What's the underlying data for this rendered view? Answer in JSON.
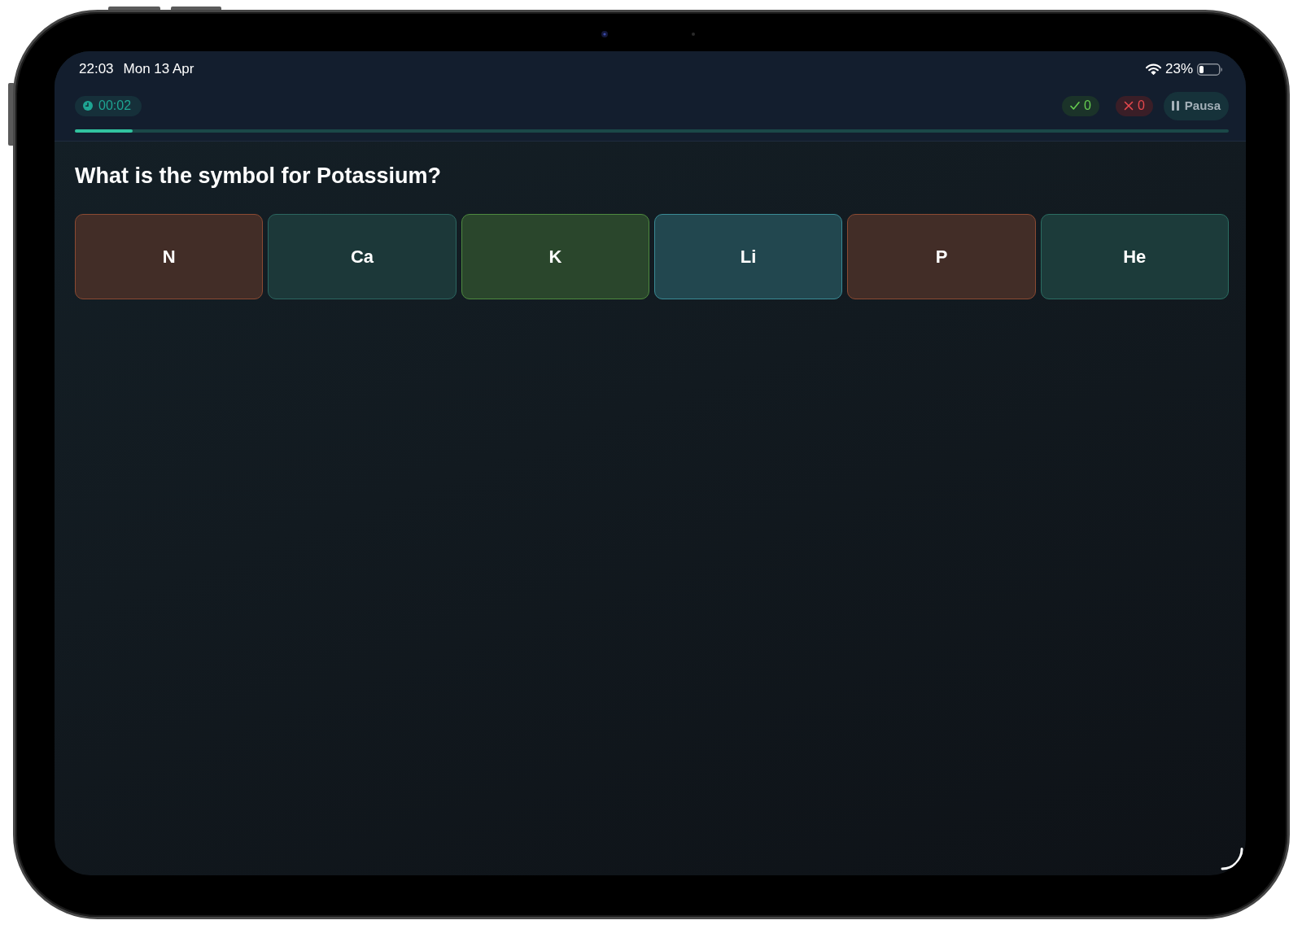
{
  "status_bar": {
    "time": "22:03",
    "date": "Mon 13 Apr",
    "battery": "23%"
  },
  "quiz_bar": {
    "timer": "00:02",
    "correct": "0",
    "wrong": "0",
    "pause_button": "Pausa",
    "progress": {
      "level": 0.05
    }
  },
  "question": "What is the symbol for Potassium?",
  "options": [
    {
      "label": "N",
      "color": "#8b4a32"
    },
    {
      "label": "Ca",
      "color": "#2b6660"
    },
    {
      "label": "K",
      "color": "#4e8a3f"
    },
    {
      "label": "Li",
      "color": "#3a8b96"
    },
    {
      "label": "P",
      "color": "#8b4a32"
    },
    {
      "label": "He",
      "color": "#2b6d62"
    }
  ]
}
